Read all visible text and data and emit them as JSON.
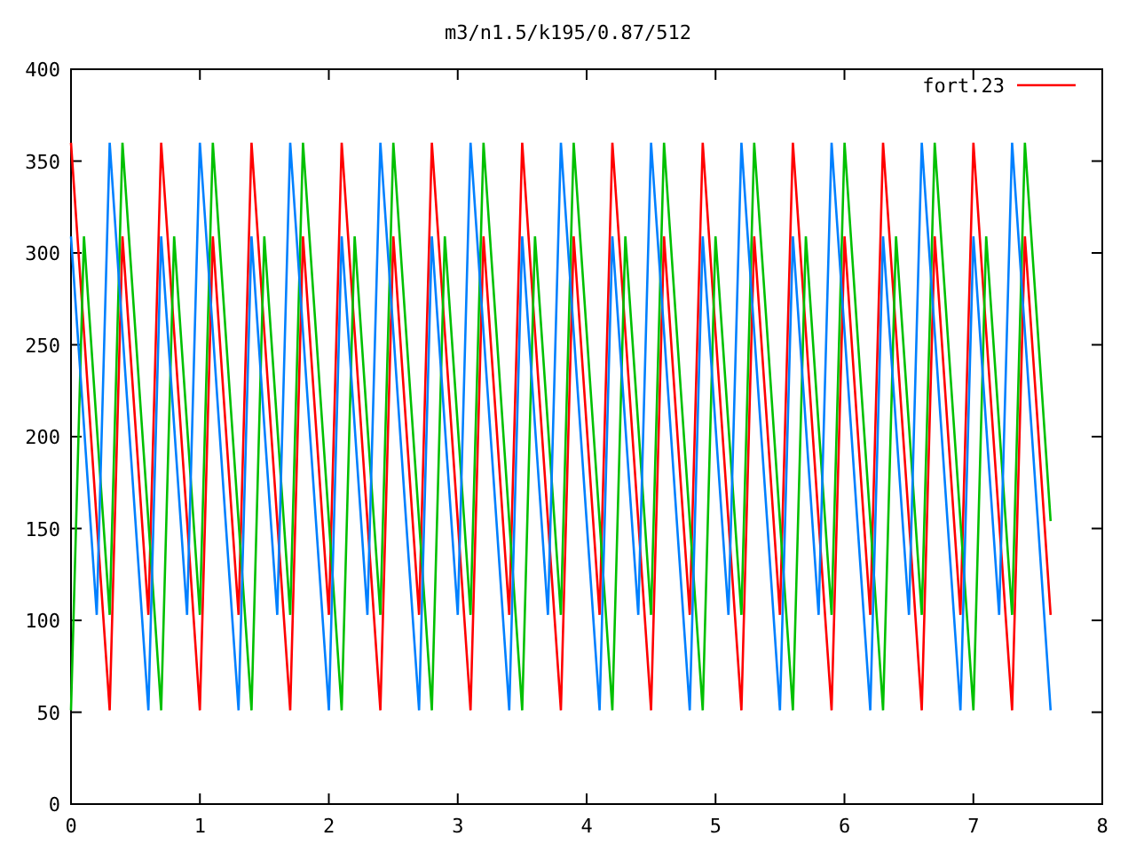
{
  "plot": {
    "chart_data": {
      "type": "line",
      "title": "m3/n1.5/k195/0.87/512",
      "xlim": [
        0,
        8
      ],
      "ylim": [
        0,
        400
      ],
      "xticks": [
        0,
        1,
        2,
        3,
        4,
        5,
        6,
        7,
        8
      ],
      "yticks": [
        0,
        50,
        100,
        150,
        200,
        250,
        300,
        350,
        400
      ],
      "x": [
        0,
        0.1,
        0.2,
        0.3,
        0.4,
        0.5,
        0.6,
        0.7,
        0.8,
        0.9,
        1,
        1.1,
        1.2,
        1.3,
        1.4,
        1.5,
        1.6,
        1.7,
        1.8,
        1.9,
        2,
        2.1,
        2.2,
        2.3,
        2.4,
        2.5,
        2.6,
        2.7,
        2.8,
        2.9,
        3,
        3.1,
        3.2,
        3.3,
        3.4,
        3.5,
        3.6,
        3.7,
        3.8,
        3.9,
        4,
        4.1,
        4.2,
        4.3,
        4.4,
        4.5,
        4.6,
        4.7,
        4.8,
        4.9,
        5,
        5.1,
        5.2,
        5.3,
        5.4,
        5.5,
        5.6,
        5.7,
        5.8,
        5.9,
        6,
        6.1,
        6.2,
        6.3,
        6.4,
        6.5,
        6.6,
        6.7,
        6.8,
        6.9,
        7,
        7.1,
        7.2,
        7.3,
        7.4,
        7.5,
        7.6
      ],
      "series": [
        {
          "name": "fort.23",
          "color": "#ff0000",
          "values": [
            360,
            257,
            154,
            51,
            309,
            206,
            103,
            360,
            257,
            154,
            51,
            309,
            206,
            103,
            360,
            257,
            154,
            51,
            309,
            206,
            103,
            360,
            257,
            154,
            51,
            309,
            206,
            103,
            360,
            257,
            154,
            51,
            309,
            206,
            103,
            360,
            257,
            154,
            51,
            309,
            206,
            103,
            360,
            257,
            154,
            51,
            309,
            206,
            103,
            360,
            257,
            154,
            51,
            309,
            206,
            103,
            360,
            257,
            154,
            51,
            309,
            206,
            103,
            360,
            257,
            154,
            51,
            309,
            206,
            103,
            360,
            257,
            154,
            51,
            309,
            206,
            103
          ]
        },
        {
          "color": "#00c000",
          "values": [
            51,
            309,
            206,
            103,
            360,
            257,
            154,
            51,
            309,
            206,
            103,
            360,
            257,
            154,
            51,
            309,
            206,
            103,
            360,
            257,
            154,
            51,
            309,
            206,
            103,
            360,
            257,
            154,
            51,
            309,
            206,
            103,
            360,
            257,
            154,
            51,
            309,
            206,
            103,
            360,
            257,
            154,
            51,
            309,
            206,
            103,
            360,
            257,
            154,
            51,
            309,
            206,
            103,
            360,
            257,
            154,
            51,
            309,
            206,
            103,
            360,
            257,
            154,
            51,
            309,
            206,
            103,
            360,
            257,
            154,
            51,
            309,
            206,
            103,
            360,
            257,
            154
          ]
        },
        {
          "color": "#0080ff",
          "values": [
            309,
            206,
            103,
            360,
            257,
            154,
            51,
            309,
            206,
            103,
            360,
            257,
            154,
            51,
            309,
            206,
            103,
            360,
            257,
            154,
            51,
            309,
            206,
            103,
            360,
            257,
            154,
            51,
            309,
            206,
            103,
            360,
            257,
            154,
            51,
            309,
            206,
            103,
            360,
            257,
            154,
            51,
            309,
            206,
            103,
            360,
            257,
            154,
            51,
            309,
            206,
            103,
            360,
            257,
            154,
            51,
            309,
            206,
            103,
            360,
            257,
            154,
            51,
            309,
            206,
            103,
            360,
            257,
            154,
            51,
            309,
            206,
            103,
            360,
            257,
            154,
            51
          ]
        }
      ]
    }
  }
}
